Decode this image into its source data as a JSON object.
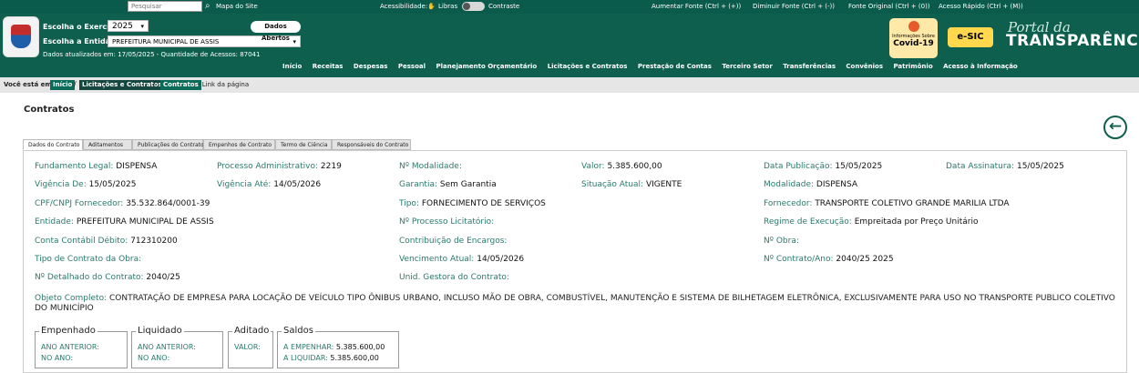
{
  "topbar": {
    "search_placeholder": "Pesquisar",
    "sitemap": "Mapa do Site",
    "accessibility": "Acessibilidade:",
    "libras": "Libras",
    "contrast": "Contraste",
    "increase_font": "Aumentar Fonte (Ctrl + (+))",
    "decrease_font": "Diminuir Fonte (Ctrl + (-))",
    "original_font": "Fonte Original (Ctrl + (0))",
    "quick_access": "Acesso Rápido (Ctrl + (M))"
  },
  "header": {
    "exercicio_label": "Escolha o Exercício:",
    "exercicio_value": "2025",
    "entidade_label": "Escolha a Entidade:",
    "entidade_value": "PREFEITURA MUNICIPAL DE ASSIS",
    "dados_abertos": "Dados Abertos",
    "updated": "Dados atualizados em: 17/05/2025 - Quantidade de Acessos: 87041",
    "nav": [
      "Início",
      "Receitas",
      "Despesas",
      "Pessoal",
      "Planejamento Orçamentário",
      "Licitações e Contratos",
      "Prestação de Contas",
      "Terceiro Setor",
      "Transferências",
      "Convênios",
      "Patrimônio",
      "Acesso à Informação"
    ],
    "covid_small": "Informações Sobre",
    "covid_big": "Covid-19",
    "esic": "e-SIC",
    "portal_small": "Portal da",
    "portal_big": "TRANSPARÊNCIA"
  },
  "breadcrumb": {
    "label": "Você está em:",
    "items": [
      "Início",
      "Licitações e Contratos",
      "Contratos"
    ],
    "note": "- Link da página"
  },
  "page": {
    "title": "Contratos",
    "tabs": [
      "Dados do Contrato",
      "Aditamentos",
      "Publicações do Contrato",
      "Empenhos de Contrato",
      "Termo de Ciência",
      "Responsáveis do Contrato"
    ]
  },
  "fields": [
    {
      "k": "Fundamento Legal:",
      "v": "DISPENSA"
    },
    {
      "k": "Processo Administrativo:",
      "v": "2219"
    },
    {
      "k": "Nº Modalidade:",
      "v": ""
    },
    {
      "k": "Valor:",
      "v": "5.385.600,00"
    },
    {
      "k": "Data Publicação:",
      "v": "15/05/2025"
    },
    {
      "k": "Data Assinatura:",
      "v": "15/05/2025"
    },
    {
      "k": "Vigência De:",
      "v": "15/05/2025"
    },
    {
      "k": "Vigência Até:",
      "v": "14/05/2026"
    },
    {
      "k": "Garantia:",
      "v": "Sem Garantia"
    },
    {
      "k": "Situação Atual:",
      "v": "VIGENTE"
    },
    {
      "k": "Modalidade:",
      "v": "DISPENSA"
    },
    {
      "k": "CPF/CNPJ Fornecedor:",
      "v": "35.532.864/0001-39"
    },
    {
      "k": "Tipo:",
      "v": "FORNECIMENTO DE SERVIÇOS"
    },
    {
      "k": "Fornecedor:",
      "v": "TRANSPORTE COLETIVO GRANDE MARILIA LTDA"
    },
    {
      "k": "Entidade:",
      "v": "PREFEITURA MUNICIPAL DE ASSIS"
    },
    {
      "k": "Nº Processo Licitatório:",
      "v": ""
    },
    {
      "k": "Regime de Execução:",
      "v": "Empreitada por Preço Unitário"
    },
    {
      "k": "Conta Contábil Débito:",
      "v": "712310200"
    },
    {
      "k": "Contribuição de Encargos:",
      "v": ""
    },
    {
      "k": "Nº Obra:",
      "v": ""
    },
    {
      "k": "Tipo de Contrato da Obra:",
      "v": ""
    },
    {
      "k": "Vencimento Atual:",
      "v": "14/05/2026"
    },
    {
      "k": "Nº Contrato/Ano:",
      "v": "2040/25 2025"
    },
    {
      "k": "Nº Detalhado do Contrato:",
      "v": "2040/25"
    },
    {
      "k": "Unid. Gestora do Contrato:",
      "v": ""
    }
  ],
  "objeto": {
    "k": "Objeto Completo:",
    "v": "CONTRATAÇÃO DE EMPRESA PARA LOCAÇÃO DE VEÍCULO TIPO ÔNIBUS URBANO, INCLUSO MÃO DE OBRA, COMBUSTÍVEL, MANUTENÇÃO E SISTEMA DE BILHETAGEM ELETRÔNICA, EXCLUSIVAMENTE PARA USO NO TRANSPORTE PUBLICO COLETIVO DO MUNICÍPIO"
  },
  "boxes": {
    "empenhado": {
      "title": "Empenhado",
      "r1": "ANO ANTERIOR:",
      "r2": "NO ANO:"
    },
    "liquidado": {
      "title": "Liquidado",
      "r1": "ANO ANTERIOR:",
      "r2": "NO ANO:"
    },
    "aditado": {
      "title": "Aditado",
      "r1": "VALOR:"
    },
    "saldos": {
      "title": "Saldos",
      "r1k": "A EMPENHAR:",
      "r1v": "5.385.600,00",
      "r2k": "A LIQUIDAR:",
      "r2v": "5.385.600,00"
    }
  }
}
